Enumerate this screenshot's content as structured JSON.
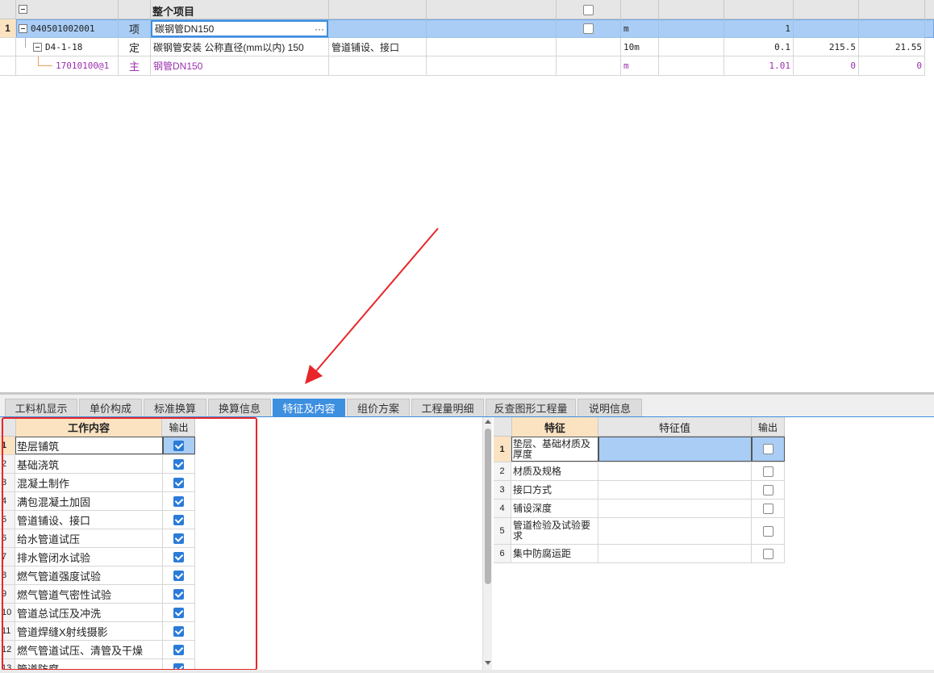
{
  "top_grid": {
    "header_title": "整个项目",
    "rows": [
      {
        "num": "1",
        "code": "040501002001",
        "type": "项",
        "name": "碳钢管DN150",
        "desc": "",
        "unit": "m",
        "qty": "1",
        "price": "",
        "total": ""
      },
      {
        "num": "",
        "code": "D4-1-18",
        "type": "定",
        "name": "碳钢管安装 公称直径(mm以内) 150",
        "desc": "管道铺设、接口",
        "unit": "10m",
        "qty": "0.1",
        "price": "215.5",
        "total": "21.55"
      },
      {
        "num": "",
        "code": "17010100@1",
        "type": "主",
        "name": "钢管DN150",
        "desc": "",
        "unit": "m",
        "qty": "1.01",
        "price": "0",
        "total": "0"
      }
    ],
    "ellipsis": "···"
  },
  "tabs": [
    "工料机显示",
    "单价构成",
    "标准换算",
    "换算信息",
    "特征及内容",
    "组价方案",
    "工程量明细",
    "反查图形工程量",
    "说明信息"
  ],
  "active_tab": "特征及内容",
  "work_content": {
    "col_content": "工作内容",
    "col_output": "输出",
    "items": [
      {
        "n": "1",
        "text": "垫层铺筑",
        "checked": true
      },
      {
        "n": "2",
        "text": "基础浇筑",
        "checked": true
      },
      {
        "n": "3",
        "text": "混凝土制作",
        "checked": true
      },
      {
        "n": "4",
        "text": "满包混凝土加固",
        "checked": true
      },
      {
        "n": "5",
        "text": "管道铺设、接口",
        "checked": true
      },
      {
        "n": "6",
        "text": "给水管道试压",
        "checked": true
      },
      {
        "n": "7",
        "text": "排水管闭水试验",
        "checked": true
      },
      {
        "n": "8",
        "text": "燃气管道强度试验",
        "checked": true
      },
      {
        "n": "9",
        "text": "燃气管道气密性试验",
        "checked": true
      },
      {
        "n": "10",
        "text": "管道总试压及冲洗",
        "checked": true
      },
      {
        "n": "11",
        "text": "管道焊缝X射线摄影",
        "checked": true
      },
      {
        "n": "12",
        "text": "燃气管道试压、清管及干燥",
        "checked": true
      },
      {
        "n": "13",
        "text": "管道防腐",
        "checked": true
      }
    ]
  },
  "features": {
    "col_feature": "特征",
    "col_value": "特征值",
    "col_output": "输出",
    "items": [
      {
        "n": "1",
        "text": "垫层、基础材质及厚度",
        "value": "",
        "checked": false
      },
      {
        "n": "2",
        "text": "材质及规格",
        "value": "",
        "checked": false
      },
      {
        "n": "3",
        "text": "接口方式",
        "value": "",
        "checked": false
      },
      {
        "n": "4",
        "text": "铺设深度",
        "value": "",
        "checked": false
      },
      {
        "n": "5",
        "text": "管道检验及试验要求",
        "value": "",
        "checked": false
      },
      {
        "n": "6",
        "text": "集中防腐运距",
        "value": "",
        "checked": false
      }
    ]
  },
  "colors": {
    "accent": "#3d8fe0",
    "selected_row": "#a9cdf5",
    "highlight_box": "#e8262a",
    "arrow": "#e8262a",
    "purple_text": "#9b2fae"
  }
}
